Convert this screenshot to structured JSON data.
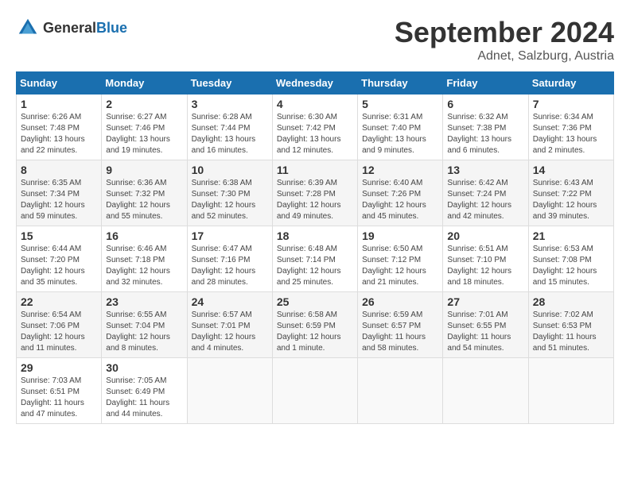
{
  "header": {
    "logo": {
      "general": "General",
      "blue": "Blue"
    },
    "title": "September 2024",
    "location": "Adnet, Salzburg, Austria"
  },
  "calendar": {
    "days_of_week": [
      "Sunday",
      "Monday",
      "Tuesday",
      "Wednesday",
      "Thursday",
      "Friday",
      "Saturday"
    ],
    "weeks": [
      [
        {
          "day": "",
          "detail": ""
        },
        {
          "day": "2",
          "detail": "Sunrise: 6:27 AM\nSunset: 7:46 PM\nDaylight: 13 hours\nand 19 minutes."
        },
        {
          "day": "3",
          "detail": "Sunrise: 6:28 AM\nSunset: 7:44 PM\nDaylight: 13 hours\nand 16 minutes."
        },
        {
          "day": "4",
          "detail": "Sunrise: 6:30 AM\nSunset: 7:42 PM\nDaylight: 13 hours\nand 12 minutes."
        },
        {
          "day": "5",
          "detail": "Sunrise: 6:31 AM\nSunset: 7:40 PM\nDaylight: 13 hours\nand 9 minutes."
        },
        {
          "day": "6",
          "detail": "Sunrise: 6:32 AM\nSunset: 7:38 PM\nDaylight: 13 hours\nand 6 minutes."
        },
        {
          "day": "7",
          "detail": "Sunrise: 6:34 AM\nSunset: 7:36 PM\nDaylight: 13 hours\nand 2 minutes."
        }
      ],
      [
        {
          "day": "1",
          "detail": "Sunrise: 6:26 AM\nSunset: 7:48 PM\nDaylight: 13 hours\nand 22 minutes."
        },
        {
          "day": "",
          "detail": ""
        },
        {
          "day": "",
          "detail": ""
        },
        {
          "day": "",
          "detail": ""
        },
        {
          "day": "",
          "detail": ""
        },
        {
          "day": "",
          "detail": ""
        },
        {
          "day": "",
          "detail": ""
        }
      ],
      [
        {
          "day": "8",
          "detail": "Sunrise: 6:35 AM\nSunset: 7:34 PM\nDaylight: 12 hours\nand 59 minutes."
        },
        {
          "day": "9",
          "detail": "Sunrise: 6:36 AM\nSunset: 7:32 PM\nDaylight: 12 hours\nand 55 minutes."
        },
        {
          "day": "10",
          "detail": "Sunrise: 6:38 AM\nSunset: 7:30 PM\nDaylight: 12 hours\nand 52 minutes."
        },
        {
          "day": "11",
          "detail": "Sunrise: 6:39 AM\nSunset: 7:28 PM\nDaylight: 12 hours\nand 49 minutes."
        },
        {
          "day": "12",
          "detail": "Sunrise: 6:40 AM\nSunset: 7:26 PM\nDaylight: 12 hours\nand 45 minutes."
        },
        {
          "day": "13",
          "detail": "Sunrise: 6:42 AM\nSunset: 7:24 PM\nDaylight: 12 hours\nand 42 minutes."
        },
        {
          "day": "14",
          "detail": "Sunrise: 6:43 AM\nSunset: 7:22 PM\nDaylight: 12 hours\nand 39 minutes."
        }
      ],
      [
        {
          "day": "15",
          "detail": "Sunrise: 6:44 AM\nSunset: 7:20 PM\nDaylight: 12 hours\nand 35 minutes."
        },
        {
          "day": "16",
          "detail": "Sunrise: 6:46 AM\nSunset: 7:18 PM\nDaylight: 12 hours\nand 32 minutes."
        },
        {
          "day": "17",
          "detail": "Sunrise: 6:47 AM\nSunset: 7:16 PM\nDaylight: 12 hours\nand 28 minutes."
        },
        {
          "day": "18",
          "detail": "Sunrise: 6:48 AM\nSunset: 7:14 PM\nDaylight: 12 hours\nand 25 minutes."
        },
        {
          "day": "19",
          "detail": "Sunrise: 6:50 AM\nSunset: 7:12 PM\nDaylight: 12 hours\nand 21 minutes."
        },
        {
          "day": "20",
          "detail": "Sunrise: 6:51 AM\nSunset: 7:10 PM\nDaylight: 12 hours\nand 18 minutes."
        },
        {
          "day": "21",
          "detail": "Sunrise: 6:53 AM\nSunset: 7:08 PM\nDaylight: 12 hours\nand 15 minutes."
        }
      ],
      [
        {
          "day": "22",
          "detail": "Sunrise: 6:54 AM\nSunset: 7:06 PM\nDaylight: 12 hours\nand 11 minutes."
        },
        {
          "day": "23",
          "detail": "Sunrise: 6:55 AM\nSunset: 7:04 PM\nDaylight: 12 hours\nand 8 minutes."
        },
        {
          "day": "24",
          "detail": "Sunrise: 6:57 AM\nSunset: 7:01 PM\nDaylight: 12 hours\nand 4 minutes."
        },
        {
          "day": "25",
          "detail": "Sunrise: 6:58 AM\nSunset: 6:59 PM\nDaylight: 12 hours\nand 1 minute."
        },
        {
          "day": "26",
          "detail": "Sunrise: 6:59 AM\nSunset: 6:57 PM\nDaylight: 11 hours\nand 58 minutes."
        },
        {
          "day": "27",
          "detail": "Sunrise: 7:01 AM\nSunset: 6:55 PM\nDaylight: 11 hours\nand 54 minutes."
        },
        {
          "day": "28",
          "detail": "Sunrise: 7:02 AM\nSunset: 6:53 PM\nDaylight: 11 hours\nand 51 minutes."
        }
      ],
      [
        {
          "day": "29",
          "detail": "Sunrise: 7:03 AM\nSunset: 6:51 PM\nDaylight: 11 hours\nand 47 minutes."
        },
        {
          "day": "30",
          "detail": "Sunrise: 7:05 AM\nSunset: 6:49 PM\nDaylight: 11 hours\nand 44 minutes."
        },
        {
          "day": "",
          "detail": ""
        },
        {
          "day": "",
          "detail": ""
        },
        {
          "day": "",
          "detail": ""
        },
        {
          "day": "",
          "detail": ""
        },
        {
          "day": "",
          "detail": ""
        }
      ]
    ]
  }
}
